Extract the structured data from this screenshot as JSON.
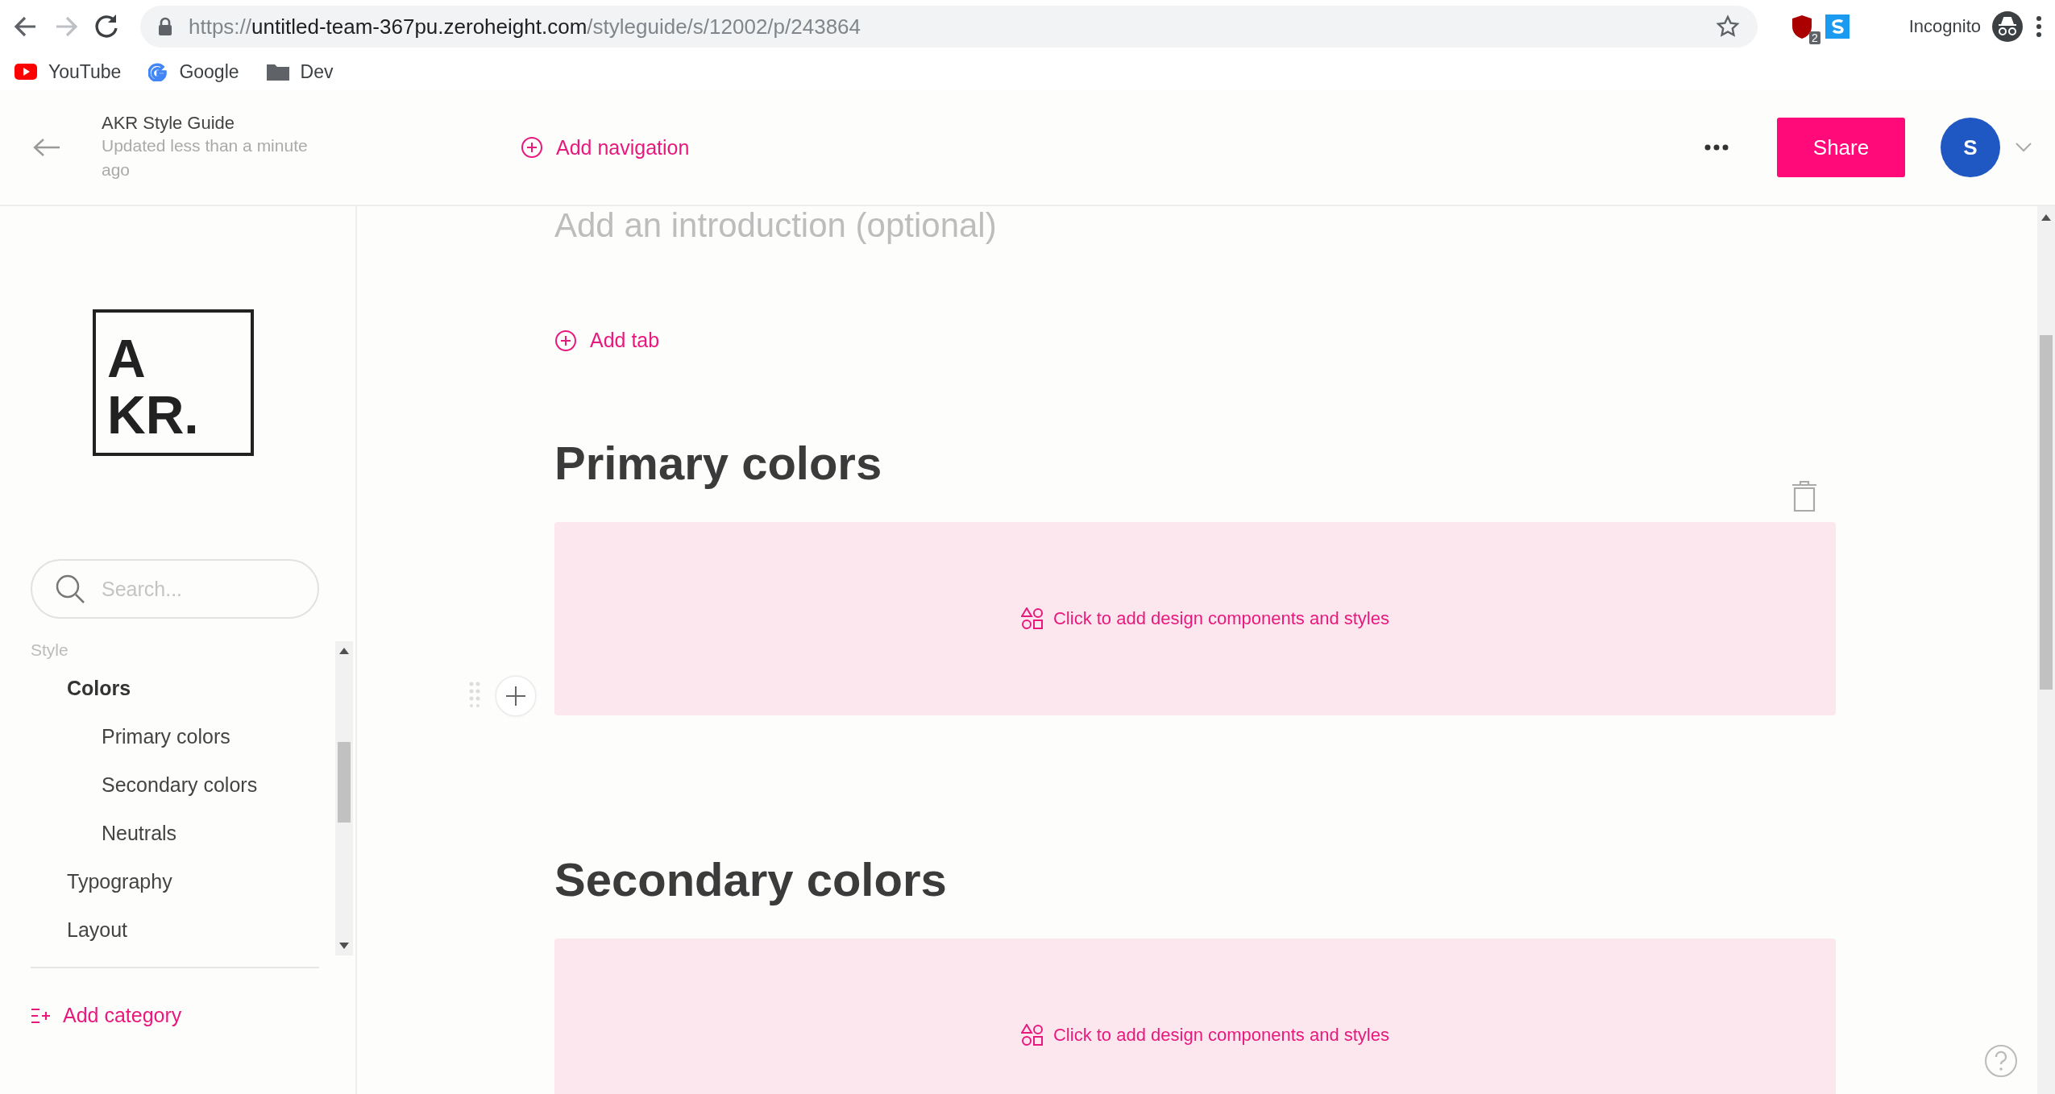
{
  "browser": {
    "url": {
      "scheme": "https://",
      "host": "untitled-team-367pu.zeroheight.com",
      "path": "/styleguide/s/12002/p/243864"
    },
    "extension_badge": "2",
    "profile": "Incognito",
    "bookmarks": [
      {
        "label": "YouTube",
        "kind": "video"
      },
      {
        "label": "Google",
        "kind": "google"
      },
      {
        "label": "Dev",
        "kind": "folder"
      }
    ]
  },
  "header": {
    "title": "AKR Style Guide",
    "subtitle": "Updated less than a minute ago",
    "add_navigation": "Add navigation",
    "share": "Share",
    "avatar": "S"
  },
  "sidebar": {
    "logo": [
      "A",
      "KR."
    ],
    "search": {
      "placeholder": "Search..."
    },
    "nav": [
      {
        "label": "Style",
        "children": [
          {
            "label": "Colors",
            "selected": true,
            "children": [
              {
                "label": "Primary colors",
                "selected": false
              },
              {
                "label": "Secondary colors",
                "selected": false
              },
              {
                "label": "Neutrals",
                "selected": false
              }
            ]
          },
          {
            "label": "Typography",
            "selected": false
          },
          {
            "label": "Layout",
            "selected": false
          }
        ]
      }
    ],
    "add_category": "Add category"
  },
  "content": {
    "introduction": {
      "placeholder": "Add an introduction (optional)"
    },
    "add_tab": "Add tab",
    "sections": [
      {
        "heading": "Primary colors",
        "prompt": "Click to add design components and styles"
      },
      {
        "heading": "Secondary colors",
        "prompt": "Click to add design components and styles"
      }
    ]
  }
}
